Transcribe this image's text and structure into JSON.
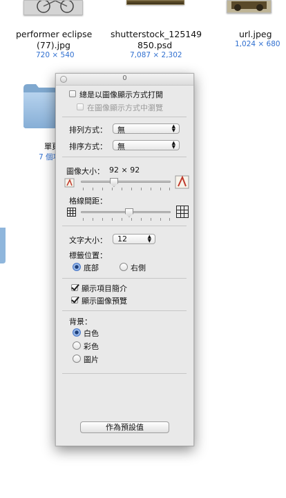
{
  "files": [
    {
      "name_line1": "performer eclipse",
      "name_line2": "(77).jpg",
      "meta": "720 × 540"
    },
    {
      "name_line1": "shutterstock_125149",
      "name_line2": "850.psd",
      "meta": "7,087 × 2,302"
    },
    {
      "name_line1": "url.jpeg",
      "meta": "1,024 × 680"
    }
  ],
  "folder_item": {
    "name_partial": "單頁",
    "meta_partial": "7 個項"
  },
  "panel": {
    "window_title": "0",
    "always_open_label": "總是以圖像顯示方式打開",
    "browse_label": "在圖像顯示方式中瀏覽",
    "arrange_label": "排列方式：",
    "arrange_value": "無",
    "sort_label": "排序方式：",
    "sort_value": "無",
    "icon_size_label": "圖像大小：",
    "icon_size_value": "92 × 92",
    "icon_size_fraction": 0.36,
    "grid_label": "格線間距：",
    "grid_fraction": 0.5,
    "text_size_label": "文字大小：",
    "text_size_value": "12",
    "label_pos_label": "標籤位置：",
    "label_bottom": "底部",
    "label_right": "右側",
    "show_info_label": "顯示項目簡介",
    "show_preview_label": "顯示圖像預覽",
    "background_label": "背景：",
    "bg_white": "白色",
    "bg_color": "彩色",
    "bg_picture": "圖片",
    "default_button": "作為預設值"
  }
}
